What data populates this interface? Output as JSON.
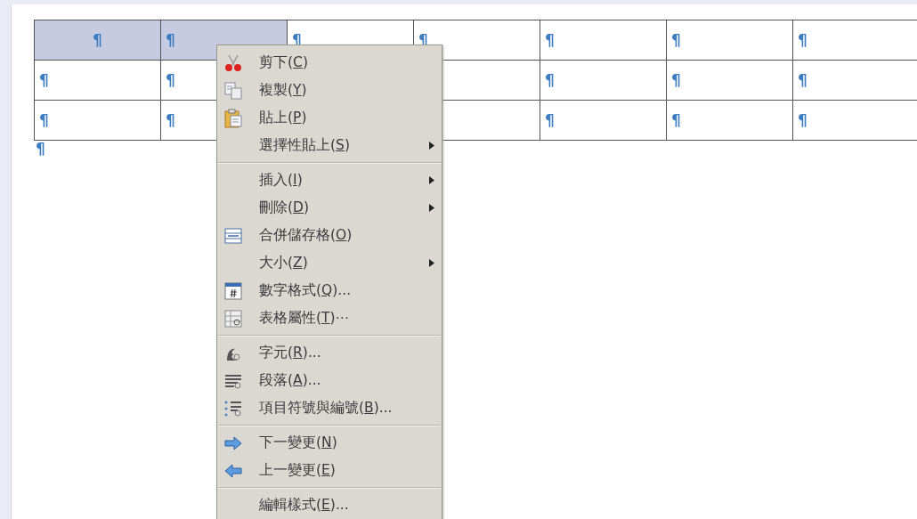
{
  "table": {
    "rows": [
      {
        "cells": [
          {
            "text": "¶",
            "selected": true
          },
          {
            "text": "¶",
            "selected": true
          },
          {
            "text": "¶",
            "selected": false
          },
          {
            "text": "¶",
            "selected": false
          },
          {
            "text": "¶",
            "selected": false
          },
          {
            "text": "¶",
            "selected": false
          },
          {
            "text": "¶",
            "selected": false
          }
        ]
      },
      {
        "cells": [
          {
            "text": "¶",
            "selected": false
          },
          {
            "text": "¶",
            "selected": false
          },
          null,
          {
            "selected": false
          },
          {
            "text": "¶",
            "selected": false
          },
          {
            "text": "¶",
            "selected": false
          },
          {
            "text": "¶",
            "selected": false
          }
        ]
      },
      {
        "cells": [
          {
            "text": "¶",
            "selected": false
          },
          {
            "text": "¶",
            "selected": false
          },
          null,
          {
            "selected": false
          },
          {
            "text": "¶",
            "selected": false
          },
          {
            "text": "¶",
            "selected": false
          },
          {
            "text": "¶",
            "selected": false
          }
        ]
      }
    ]
  },
  "paragraph_mark": "¶",
  "context_menu": {
    "items": [
      {
        "kind": "item",
        "before": "剪下(",
        "key": "C",
        "after": ")",
        "submenu": false
      },
      {
        "kind": "item",
        "before": "複製(",
        "key": "Y",
        "after": ")",
        "submenu": false
      },
      {
        "kind": "item",
        "before": "貼上(",
        "key": "P",
        "after": ")",
        "submenu": false
      },
      {
        "kind": "item",
        "before": "選擇性貼上(",
        "key": "S",
        "after": ")",
        "submenu": true
      },
      {
        "kind": "separator"
      },
      {
        "kind": "item",
        "before": "插入(",
        "key": "I",
        "after": ")",
        "submenu": true
      },
      {
        "kind": "item",
        "before": "刪除(",
        "key": "D",
        "after": ")",
        "submenu": true
      },
      {
        "kind": "item",
        "before": "合併儲存格(",
        "key": "O",
        "after": ")",
        "submenu": false
      },
      {
        "kind": "item",
        "before": "大小(",
        "key": "Z",
        "after": ")",
        "submenu": true
      },
      {
        "kind": "item",
        "before": "數字格式(",
        "key": "Q",
        "after": ")...",
        "submenu": false
      },
      {
        "kind": "item",
        "before": "表格屬性(",
        "key": "T",
        "after": ")⋯",
        "submenu": false
      },
      {
        "kind": "separator"
      },
      {
        "kind": "item",
        "before": "字元(",
        "key": "R",
        "after": ")...",
        "submenu": false
      },
      {
        "kind": "item",
        "before": "段落(",
        "key": "A",
        "after": ")...",
        "submenu": false
      },
      {
        "kind": "item",
        "before": "項目符號與編號(",
        "key": "B",
        "after": ")...",
        "submenu": false
      },
      {
        "kind": "separator"
      },
      {
        "kind": "item",
        "before": "下一變更(",
        "key": "N",
        "after": ")",
        "submenu": false
      },
      {
        "kind": "item",
        "before": "上一變更(",
        "key": "E",
        "after": ")",
        "submenu": false
      },
      {
        "kind": "separator"
      },
      {
        "kind": "item",
        "before": "編輯樣式(",
        "key": "E",
        "after": ")...",
        "submenu": false
      }
    ]
  }
}
